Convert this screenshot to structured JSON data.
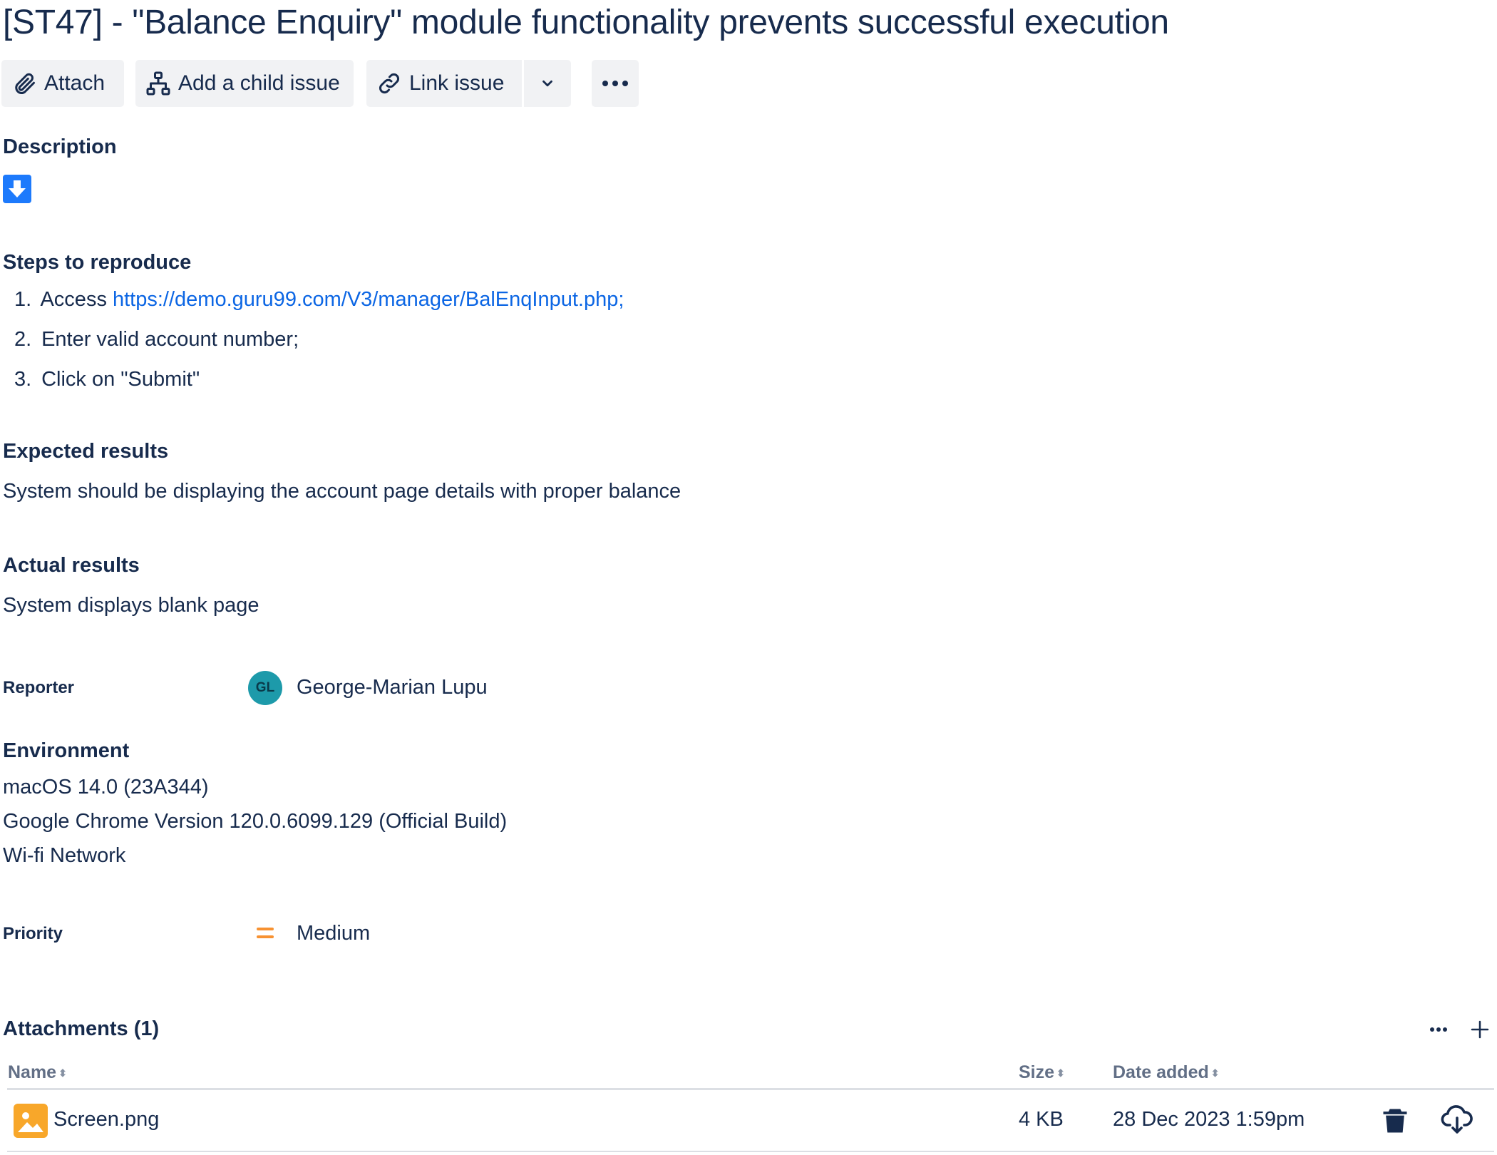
{
  "issue": {
    "title": "[ST47] - \"Balance Enquiry\" module functionality prevents successful execution"
  },
  "toolbar": {
    "attach": "Attach",
    "add_child": "Add a child issue",
    "link_issue": "Link issue"
  },
  "description": {
    "heading": "Description",
    "steps_heading": "Steps to reproduce",
    "steps": [
      {
        "num": "1.",
        "prefix": "Access ",
        "link": "https://demo.guru99.com/V3/manager/BalEnqInput.php;"
      },
      {
        "num": "2.",
        "text": "Enter valid account number;"
      },
      {
        "num": "3.",
        "text": "Click on \"Submit\""
      }
    ],
    "expected_heading": "Expected results",
    "expected_text": "System should be displaying the account page details with proper balance",
    "actual_heading": "Actual results",
    "actual_text": "System displays blank page"
  },
  "reporter": {
    "label": "Reporter",
    "initials": "GL",
    "name": "George-Marian Lupu"
  },
  "environment": {
    "heading": "Environment",
    "lines": [
      "macOS 14.0 (23A344)",
      "Google Chrome Version 120.0.6099.129 (Official Build)",
      "Wi-fi Network"
    ]
  },
  "priority": {
    "label": "Priority",
    "value": "Medium",
    "color": "#f79232"
  },
  "attachments": {
    "heading": "Attachments (1)",
    "columns": {
      "name": "Name",
      "size": "Size",
      "date": "Date added"
    },
    "rows": [
      {
        "name": "Screen.png",
        "size": "4 KB",
        "date": "28 Dec 2023 1:59pm"
      }
    ]
  },
  "icons": {
    "attach": "paperclip-icon",
    "child": "hierarchy-icon",
    "link": "link-icon",
    "more": "more-icon",
    "trash": "trash-icon",
    "download": "cloud-download-icon",
    "file": "image-file-icon"
  },
  "colors": {
    "text": "#172b4d",
    "link": "#0c66e4",
    "button_bg": "#f1f2f4",
    "file_icon": "#f8a72a",
    "avatar": "#1d9aaa"
  }
}
